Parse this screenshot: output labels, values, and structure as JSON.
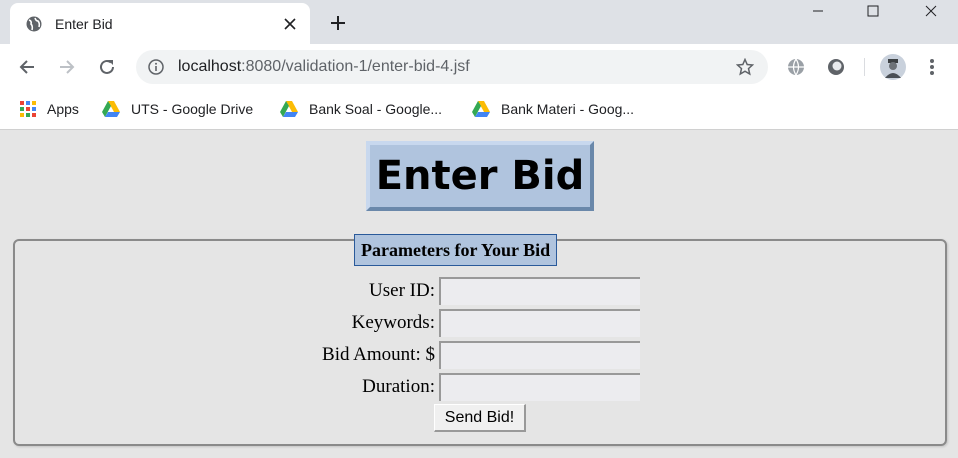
{
  "browser": {
    "tab": {
      "title": "Enter Bid"
    },
    "address_bar": {
      "host": "localhost",
      "path": ":8080/validation-1/enter-bid-4.jsf"
    },
    "bookmarks": [
      {
        "label": "Apps",
        "icon": "apps-grid-icon"
      },
      {
        "label": "UTS - Google Drive",
        "icon": "google-drive-icon"
      },
      {
        "label": "Bank Soal - Google...",
        "icon": "google-drive-icon"
      },
      {
        "label": "Bank Materi - Goog...",
        "icon": "google-drive-icon"
      }
    ]
  },
  "page": {
    "heading": "Enter Bid",
    "fieldset_legend": "Parameters for Your Bid",
    "fields": [
      {
        "label": "User ID:",
        "value": ""
      },
      {
        "label": "Keywords:",
        "value": ""
      },
      {
        "label": "Bid Amount: $",
        "value": ""
      },
      {
        "label": "Duration:",
        "value": ""
      }
    ],
    "submit_label": "Send Bid!"
  },
  "colors": {
    "heading_bg": "#b0c4de",
    "legend_border": "#2a5a9a",
    "page_bg": "#e5e5e5"
  }
}
